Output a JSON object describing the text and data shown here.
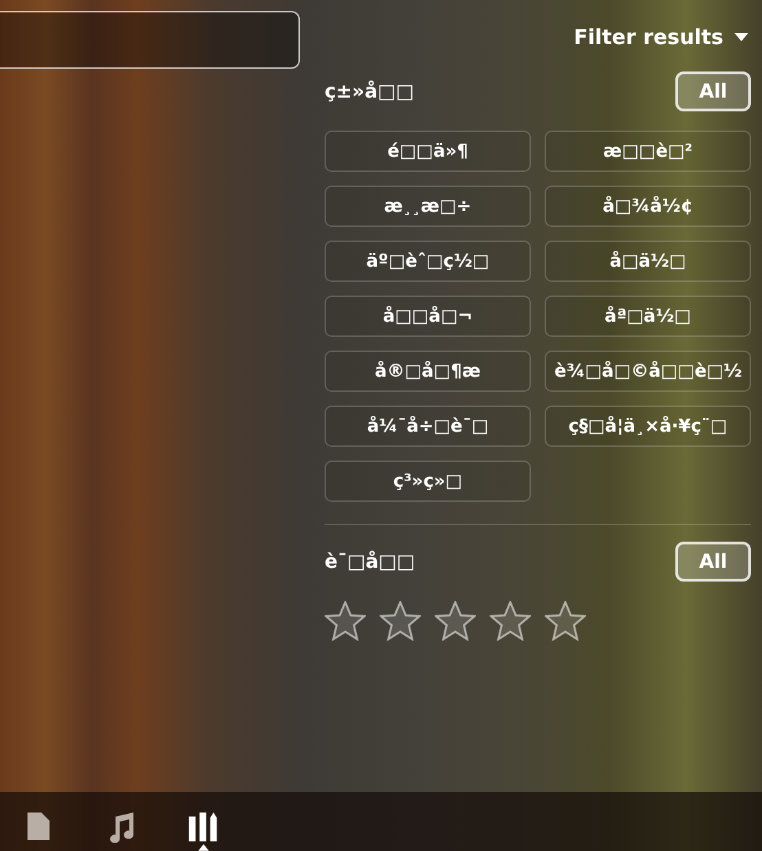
{
  "filter_toggle": {
    "label": "Filter results",
    "expanded": true
  },
  "category": {
    "title": "ç±»å□□",
    "all_button": "All",
    "options": [
      {
        "label": "é□□ä»¶",
        "selected": false
      },
      {
        "label": "æ□□è□²",
        "selected": false
      },
      {
        "label": "æ¸¸æ□÷",
        "selected": false
      },
      {
        "label": "å□¾å½¢",
        "selected": false
      },
      {
        "label": "äº□èˆ□ç½□",
        "selected": false
      },
      {
        "label": "å□ä½□",
        "selected": false
      },
      {
        "label": "å□□å□¬",
        "selected": false
      },
      {
        "label": "åª□ä½□",
        "selected": false
      },
      {
        "label": "å®□å□¶æ",
        "selected": false
      },
      {
        "label": "è¾□å□©å□□è□½",
        "selected": false
      },
      {
        "label": "å¼¯å÷□è¯□",
        "selected": false
      },
      {
        "label": "ç§□å¦ä¸×å·¥ç¨□",
        "selected": false
      },
      {
        "label": "ç³»ç»□",
        "selected": false
      }
    ]
  },
  "rating": {
    "title": "è¯□å□□",
    "all_button": "All",
    "stars": 0
  },
  "lenses": [
    {
      "kind": "files",
      "selected": false
    },
    {
      "kind": "music",
      "selected": false
    },
    {
      "kind": "apps",
      "selected": true
    }
  ]
}
